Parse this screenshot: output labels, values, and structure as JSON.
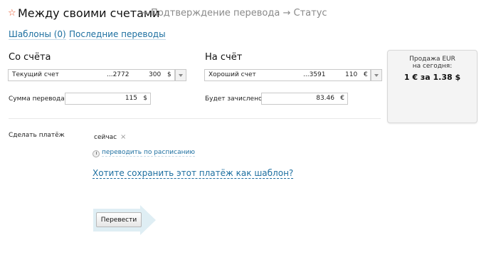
{
  "header": {
    "title": "Между своими счетами",
    "steps": [
      "Подтверждение перевода",
      "Статус"
    ],
    "arrow": "→"
  },
  "links": {
    "templates": "Шаблоны (0)",
    "recent": "Последние переводы"
  },
  "from": {
    "heading": "Со счёта",
    "account_name": "Текущий счет",
    "account_mask": "...2772",
    "balance": "300",
    "currency": "$",
    "amount_label": "Сумма перевода",
    "amount": "115",
    "amount_currency": "$"
  },
  "to": {
    "heading": "На счёт",
    "account_name": "Хороший счет",
    "account_mask": "...3591",
    "balance": "110",
    "currency": "€",
    "credited_label": "Будет зачислено",
    "credited": "83.46",
    "credited_currency": "€"
  },
  "rate": {
    "line1": "Продажа EUR",
    "line2": "на сегодня:",
    "value": "1 € за 1.38 $"
  },
  "payment": {
    "label": "Сделать платёж",
    "when": "сейчас",
    "remove_icon": "×",
    "schedule_link": "переводить по расписанию",
    "save_template_link": "Хотите сохранить этот платёж как шаблон?"
  },
  "actions": {
    "submit": "Перевести"
  },
  "colors": {
    "link": "#1d6fa0",
    "star": "#e8552b",
    "arrow_bg": "#dfeef4"
  }
}
